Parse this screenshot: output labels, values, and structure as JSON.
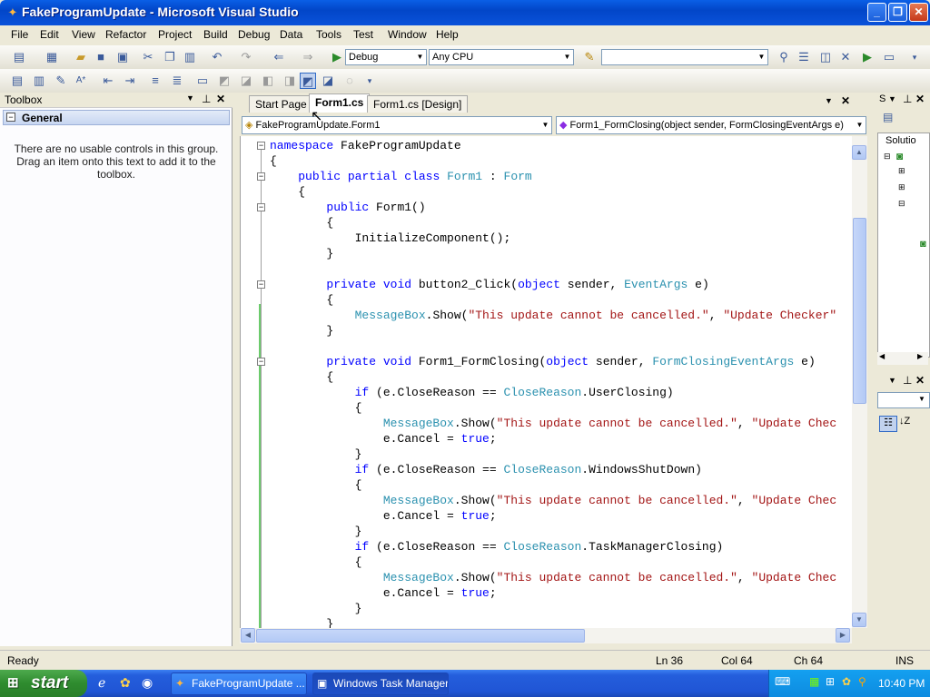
{
  "window": {
    "title": "FakeProgramUpdate - Microsoft Visual Studio"
  },
  "menu": [
    "File",
    "Edit",
    "View",
    "Refactor",
    "Project",
    "Build",
    "Debug",
    "Data",
    "Tools",
    "Test",
    "Window",
    "Help"
  ],
  "toolbar": {
    "config": "Debug",
    "platform": "Any CPU"
  },
  "toolbox": {
    "title": "Toolbox",
    "group": "General",
    "message": "There are no usable controls in this group. Drag an item onto this text to add it to the toolbox."
  },
  "tabs": [
    {
      "label": "Start Page"
    },
    {
      "label": "Form1.cs"
    },
    {
      "label": "Form1.cs [Design]"
    }
  ],
  "nav": {
    "class": "FakeProgramUpdate.Form1",
    "member": "Form1_FormClosing(object sender, FormClosingEventArgs e)"
  },
  "status": {
    "ready": "Ready",
    "ln": "Ln 36",
    "col": "Col 64",
    "ch": "Ch 64",
    "ins": "INS"
  },
  "panel": {
    "solution": "Solutio"
  },
  "taskbar": {
    "start": "start",
    "items": [
      {
        "label": "FakeProgramUpdate ..."
      },
      {
        "label": "Windows Task Manager"
      }
    ],
    "clock": "10:40 PM"
  },
  "colors": {
    "keyword": "#0000FF",
    "type": "#2B91AF",
    "string": "#A31515"
  }
}
